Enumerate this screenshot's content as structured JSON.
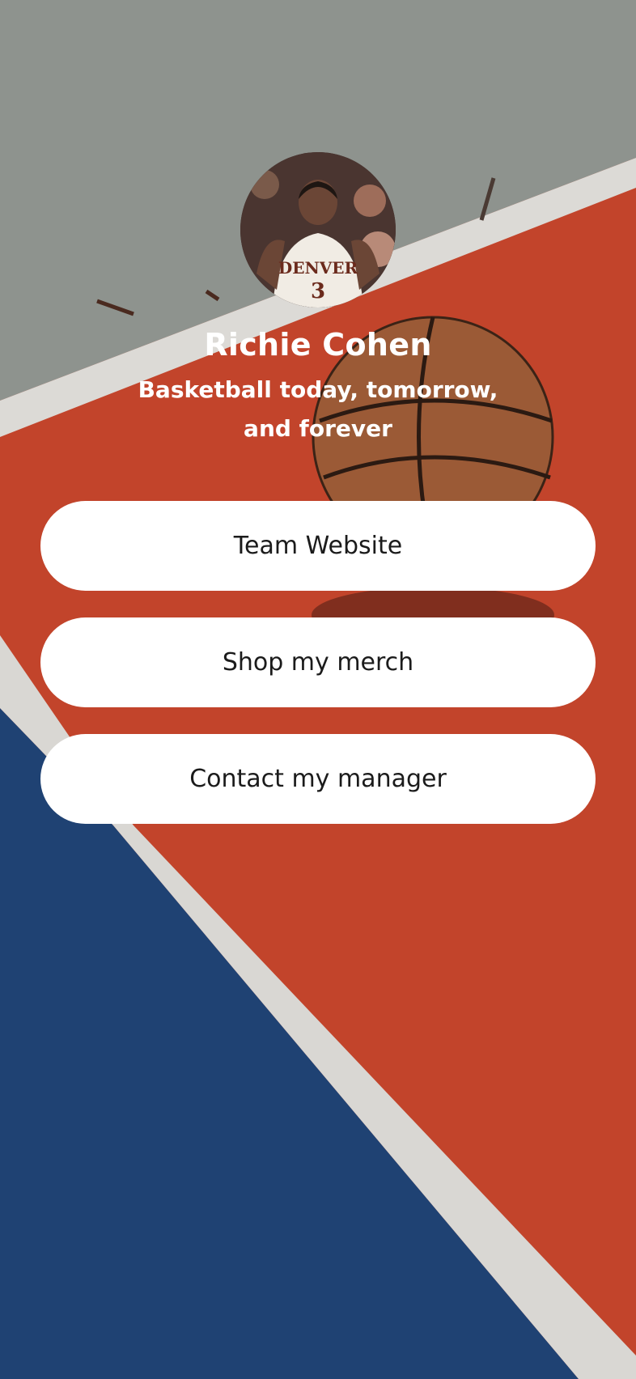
{
  "profile": {
    "name": "Richie Cohen",
    "bio": "Basketball today, tomorrow, and forever",
    "avatar_icon": "player-photo"
  },
  "links": [
    {
      "label": "Team Website"
    },
    {
      "label": "Shop my merch"
    },
    {
      "label": "Contact my manager"
    }
  ],
  "colors": {
    "court_gray": "#8f948f",
    "court_red": "#c2442b",
    "court_blue": "#1f4273",
    "court_line": "#dcdcdc",
    "button_bg": "#ffffff",
    "button_text": "#1b1b1b",
    "text_light": "#ffffff"
  }
}
